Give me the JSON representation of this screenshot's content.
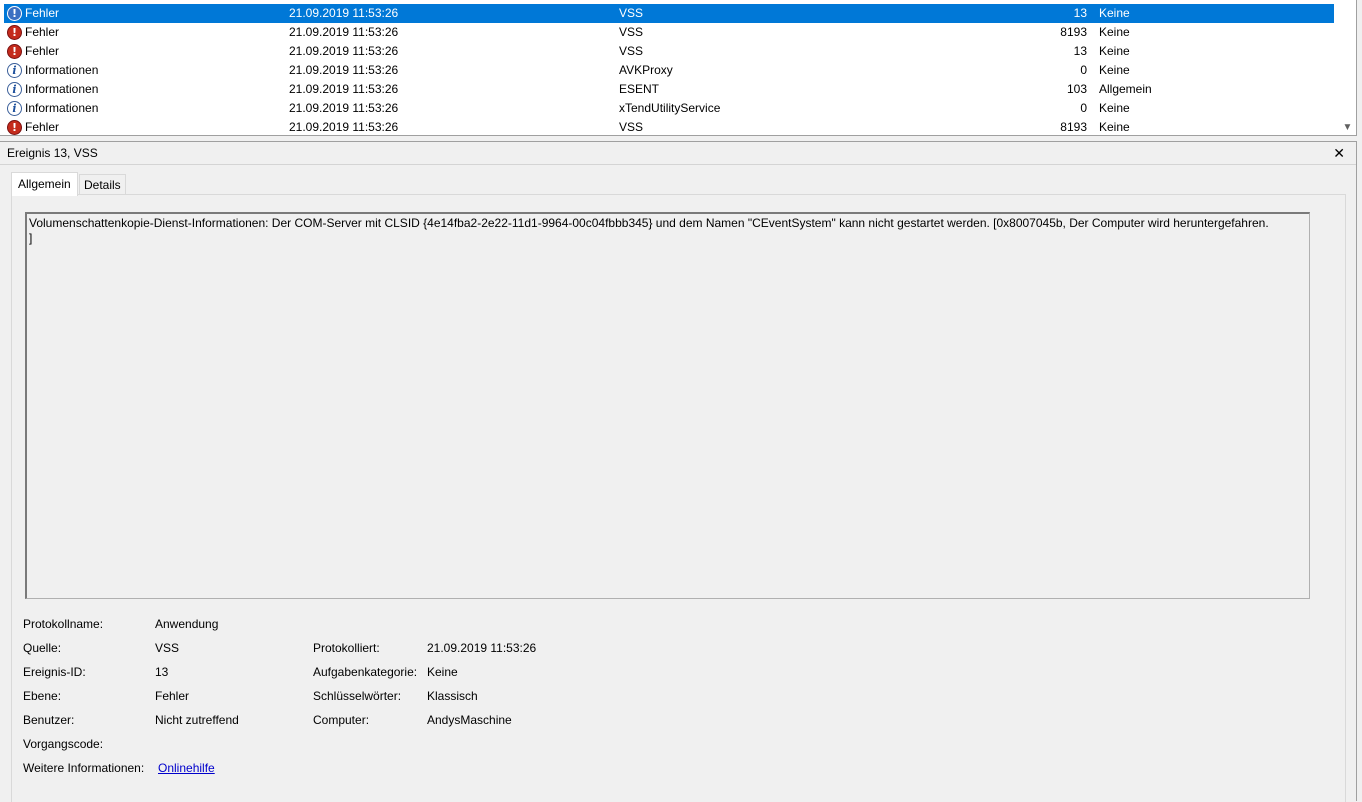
{
  "event_list": {
    "rows": [
      {
        "level": "Fehler",
        "type": "error",
        "date": "21.09.2019 11:53:26",
        "source": "VSS",
        "event_id": "13",
        "category": "Keine",
        "selected": true
      },
      {
        "level": "Fehler",
        "type": "error",
        "date": "21.09.2019 11:53:26",
        "source": "VSS",
        "event_id": "8193",
        "category": "Keine",
        "selected": false
      },
      {
        "level": "Fehler",
        "type": "error",
        "date": "21.09.2019 11:53:26",
        "source": "VSS",
        "event_id": "13",
        "category": "Keine",
        "selected": false
      },
      {
        "level": "Informationen",
        "type": "info",
        "date": "21.09.2019 11:53:26",
        "source": "AVKProxy",
        "event_id": "0",
        "category": "Keine",
        "selected": false
      },
      {
        "level": "Informationen",
        "type": "info",
        "date": "21.09.2019 11:53:26",
        "source": "ESENT",
        "event_id": "103",
        "category": "Allgemein",
        "selected": false
      },
      {
        "level": "Informationen",
        "type": "info",
        "date": "21.09.2019 11:53:26",
        "source": "xTendUtilityService",
        "event_id": "0",
        "category": "Keine",
        "selected": false
      },
      {
        "level": "Fehler",
        "type": "error",
        "date": "21.09.2019 11:53:26",
        "source": "VSS",
        "event_id": "8193",
        "category": "Keine",
        "selected": false
      }
    ],
    "icons": {
      "error": "error-icon",
      "info": "info-icon"
    },
    "selection_color": "#0078d7"
  },
  "detail": {
    "title": "Ereignis 13, VSS",
    "close_glyph": "✕",
    "tabs": {
      "general": "Allgemein",
      "details": "Details"
    },
    "message": "Volumenschattenkopie-Dienst-Informationen: Der COM-Server mit CLSID {4e14fba2-2e22-11d1-9964-00c04fbbb345} und dem Namen \"CEventSystem\" kann nicht gestartet werden. [0x8007045b, Der Computer wird heruntergefahren.\n]",
    "props": {
      "log_name_label": "Protokollname:",
      "log_name": "Anwendung",
      "source_label": "Quelle:",
      "source": "VSS",
      "logged_label": "Protokolliert:",
      "logged": "21.09.2019 11:53:26",
      "event_id_label": "Ereignis-ID:",
      "event_id": "13",
      "task_category_label": "Aufgabenkategorie:",
      "task_category": "Keine",
      "level_label": "Ebene:",
      "level": "Fehler",
      "keywords_label": "Schlüsselwörter:",
      "keywords": "Klassisch",
      "user_label": "Benutzer:",
      "user": "Nicht zutreffend",
      "computer_label": "Computer:",
      "computer": "AndysMaschine",
      "opcode_label": "Vorgangscode:",
      "opcode": "",
      "more_info_label": "Weitere Informationen:",
      "more_info_link": "Onlinehilfe"
    }
  }
}
